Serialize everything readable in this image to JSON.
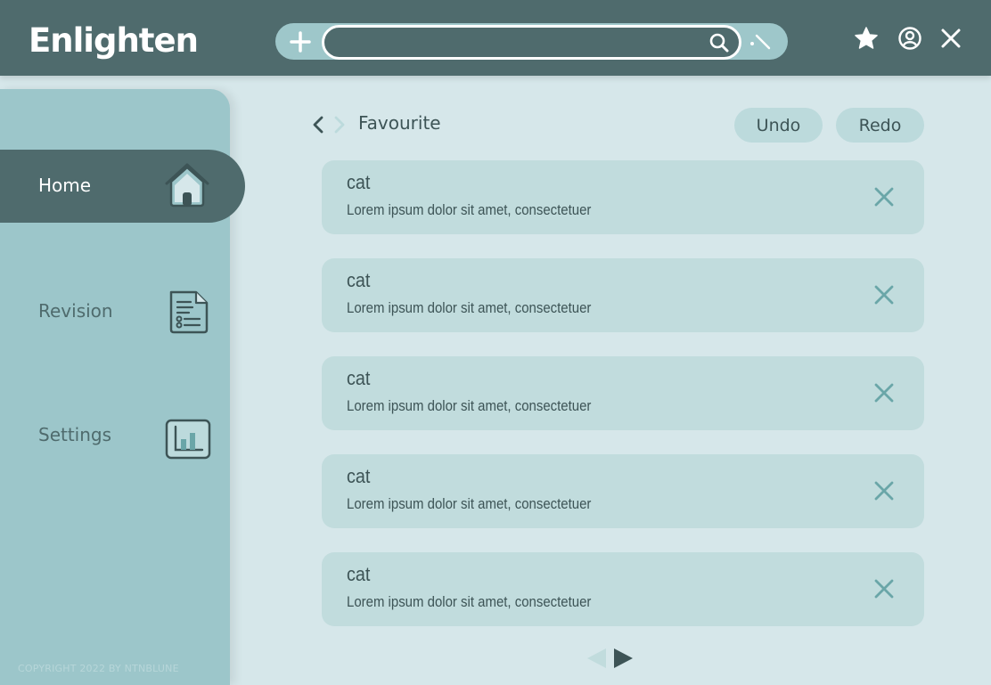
{
  "app": {
    "title": "Enlighten"
  },
  "search": {
    "placeholder": "",
    "value": ""
  },
  "sidebar": {
    "items": [
      {
        "label": "Home",
        "icon": "home-icon",
        "active": true
      },
      {
        "label": "Revision",
        "icon": "document-list-icon",
        "active": false
      },
      {
        "label": "Settings",
        "icon": "bar-chart-icon",
        "active": false
      }
    ],
    "copyright": "COPYRIGHT 2022 BY NTNBLUNE"
  },
  "breadcrumb": {
    "title": "Favourite"
  },
  "toolbar": {
    "undo_label": "Undo",
    "redo_label": "Redo"
  },
  "cards": [
    {
      "title": "cat",
      "description": "Lorem ipsum dolor sit amet, consectetuer"
    },
    {
      "title": "cat",
      "description": "Lorem ipsum dolor sit amet, consectetuer"
    },
    {
      "title": "cat",
      "description": "Lorem ipsum dolor sit amet, consectetuer"
    },
    {
      "title": "cat",
      "description": "Lorem ipsum dolor sit amet, consectetuer"
    },
    {
      "title": "cat",
      "description": "Lorem ipsum dolor sit amet, consectetuer"
    }
  ],
  "colors": {
    "header": "#4f6b6d",
    "sidebar": "#9cc6ca",
    "background": "#d6e7ea",
    "card": "#c1dcdd",
    "accent": "#6aa6a8"
  }
}
